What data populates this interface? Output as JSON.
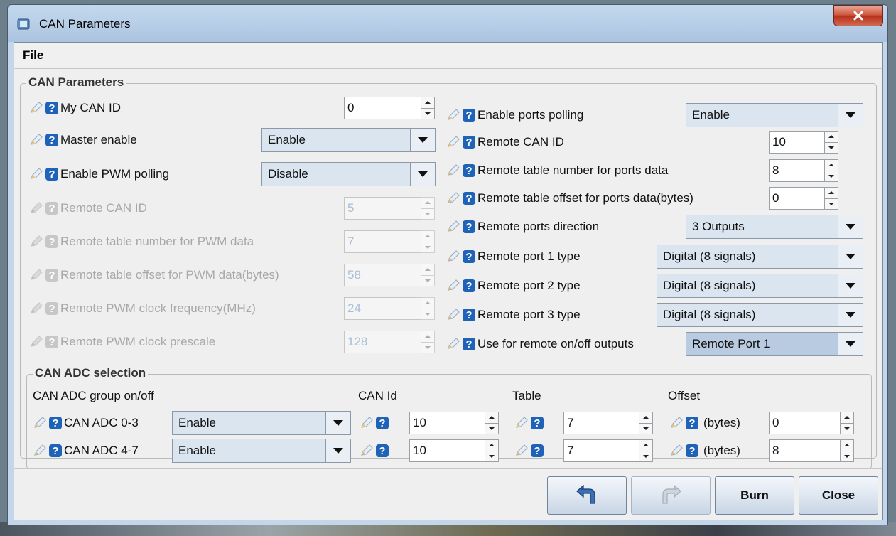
{
  "window": {
    "title": "CAN Parameters"
  },
  "menu": {
    "file_label": "File"
  },
  "can_params": {
    "legend": "CAN Parameters",
    "left": [
      {
        "label": "My CAN ID",
        "kind": "spin",
        "value": "0",
        "enabled": true
      },
      {
        "label": "Master enable",
        "kind": "combo",
        "value": "Enable",
        "enabled": true
      },
      {
        "label": "Enable PWM polling",
        "kind": "combo",
        "value": "Disable",
        "enabled": true
      },
      {
        "label": "Remote CAN ID",
        "kind": "spin",
        "value": "5",
        "enabled": false
      },
      {
        "label": "Remote table number for PWM data",
        "kind": "spin",
        "value": "7",
        "enabled": false
      },
      {
        "label": "Remote table offset for PWM data(bytes)",
        "kind": "spin",
        "value": "58",
        "enabled": false
      },
      {
        "label": "Remote PWM clock frequency(MHz)",
        "kind": "spin",
        "value": "24",
        "enabled": false
      },
      {
        "label": "Remote PWM clock prescale",
        "kind": "spin",
        "value": "128",
        "enabled": false
      }
    ],
    "right": [
      {
        "label": "Enable ports polling",
        "kind": "combo",
        "value": "Enable",
        "enabled": true
      },
      {
        "label": "Remote CAN ID",
        "kind": "spin",
        "value": "10",
        "enabled": true
      },
      {
        "label": "Remote table number for ports data",
        "kind": "spin",
        "value": "8",
        "enabled": true
      },
      {
        "label": "Remote table offset for ports data(bytes)",
        "kind": "spin",
        "value": "0",
        "enabled": true
      },
      {
        "label": "Remote ports direction",
        "kind": "combo",
        "value": "3 Outputs",
        "enabled": true
      },
      {
        "label": "Remote port 1 type",
        "kind": "combo",
        "value": "Digital (8 signals)",
        "enabled": true
      },
      {
        "label": "Remote port 2 type",
        "kind": "combo",
        "value": "Digital (8 signals)",
        "enabled": true
      },
      {
        "label": "Remote port 3 type",
        "kind": "combo",
        "value": "Digital (8 signals)",
        "enabled": true
      },
      {
        "label": "Use for remote on/off outputs",
        "kind": "combo",
        "value": "Remote Port 1",
        "enabled": true
      }
    ]
  },
  "adc": {
    "legend": "CAN ADC selection",
    "headers": {
      "group": "CAN ADC group on/off",
      "can_id": "CAN Id",
      "table": "Table",
      "offset": "Offset"
    },
    "offset_unit": "(bytes)",
    "rows": [
      {
        "label": "CAN ADC 0-3",
        "group_value": "Enable",
        "can_id": "10",
        "table": "7",
        "offset": "0"
      },
      {
        "label": "CAN ADC 4-7",
        "group_value": "Enable",
        "can_id": "10",
        "table": "7",
        "offset": "8"
      }
    ]
  },
  "footer": {
    "burn_label": "Burn",
    "close_label": "Close"
  },
  "icons": {
    "pencil": "pencil-icon",
    "help": "help-icon",
    "undo": "undo-icon",
    "redo": "redo-icon"
  }
}
